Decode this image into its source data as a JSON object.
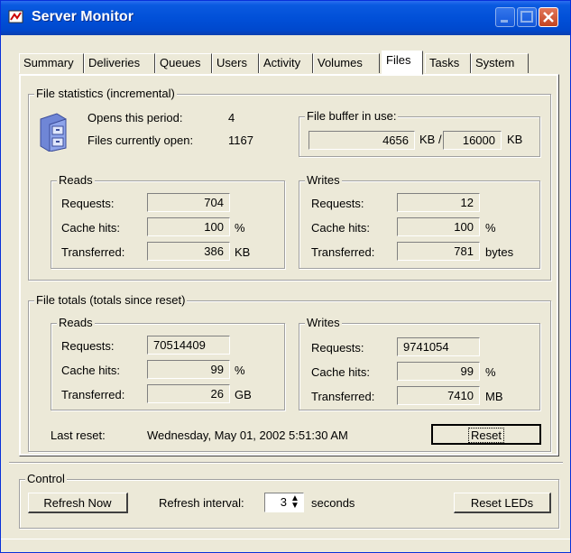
{
  "window": {
    "title": "Server Monitor"
  },
  "tabs": [
    "Summary",
    "Deliveries",
    "Queues",
    "Users",
    "Activity",
    "Volumes",
    "Files",
    "Tasks",
    "System"
  ],
  "active_tab": "Files",
  "incremental": {
    "label": "File statistics (incremental)",
    "opens_label": "Opens this period:",
    "opens_value": "4",
    "open_files_label": "Files currently open:",
    "open_files_value": "1167",
    "buffer": {
      "label": "File buffer in use:",
      "used": "4656",
      "used_unit": "KB /",
      "total": "16000",
      "total_unit": "KB"
    },
    "reads": {
      "label": "Reads",
      "requests_label": "Requests:",
      "requests": "704",
      "cache_label": "Cache hits:",
      "cache": "100",
      "cache_unit": "%",
      "transferred_label": "Transferred:",
      "transferred": "386",
      "transferred_unit": "KB"
    },
    "writes": {
      "label": "Writes",
      "requests_label": "Requests:",
      "requests": "12",
      "cache_label": "Cache hits:",
      "cache": "100",
      "cache_unit": "%",
      "transferred_label": "Transferred:",
      "transferred": "781",
      "transferred_unit": "bytes"
    }
  },
  "totals": {
    "label": "File totals (totals since reset)",
    "reads": {
      "label": "Reads",
      "requests_label": "Requests:",
      "requests": "70514409",
      "cache_label": "Cache hits:",
      "cache": "99",
      "cache_unit": "%",
      "transferred_label": "Transferred:",
      "transferred": "26",
      "transferred_unit": "GB"
    },
    "writes": {
      "label": "Writes",
      "requests_label": "Requests:",
      "requests": "9741054",
      "cache_label": "Cache hits:",
      "cache": "99",
      "cache_unit": "%",
      "transferred_label": "Transferred:",
      "transferred": "7410",
      "transferred_unit": "MB"
    },
    "last_reset_label": "Last reset:",
    "last_reset_value": "Wednesday, May 01, 2002 5:51:30 AM",
    "reset_button": "Reset"
  },
  "control": {
    "label": "Control",
    "refresh_now": "Refresh Now",
    "interval_label": "Refresh interval:",
    "interval_value": "3",
    "interval_unit": "seconds",
    "reset_leds": "Reset LEDs"
  },
  "colors": {
    "titlebar": "#0150d8",
    "face": "#ece9d8"
  }
}
